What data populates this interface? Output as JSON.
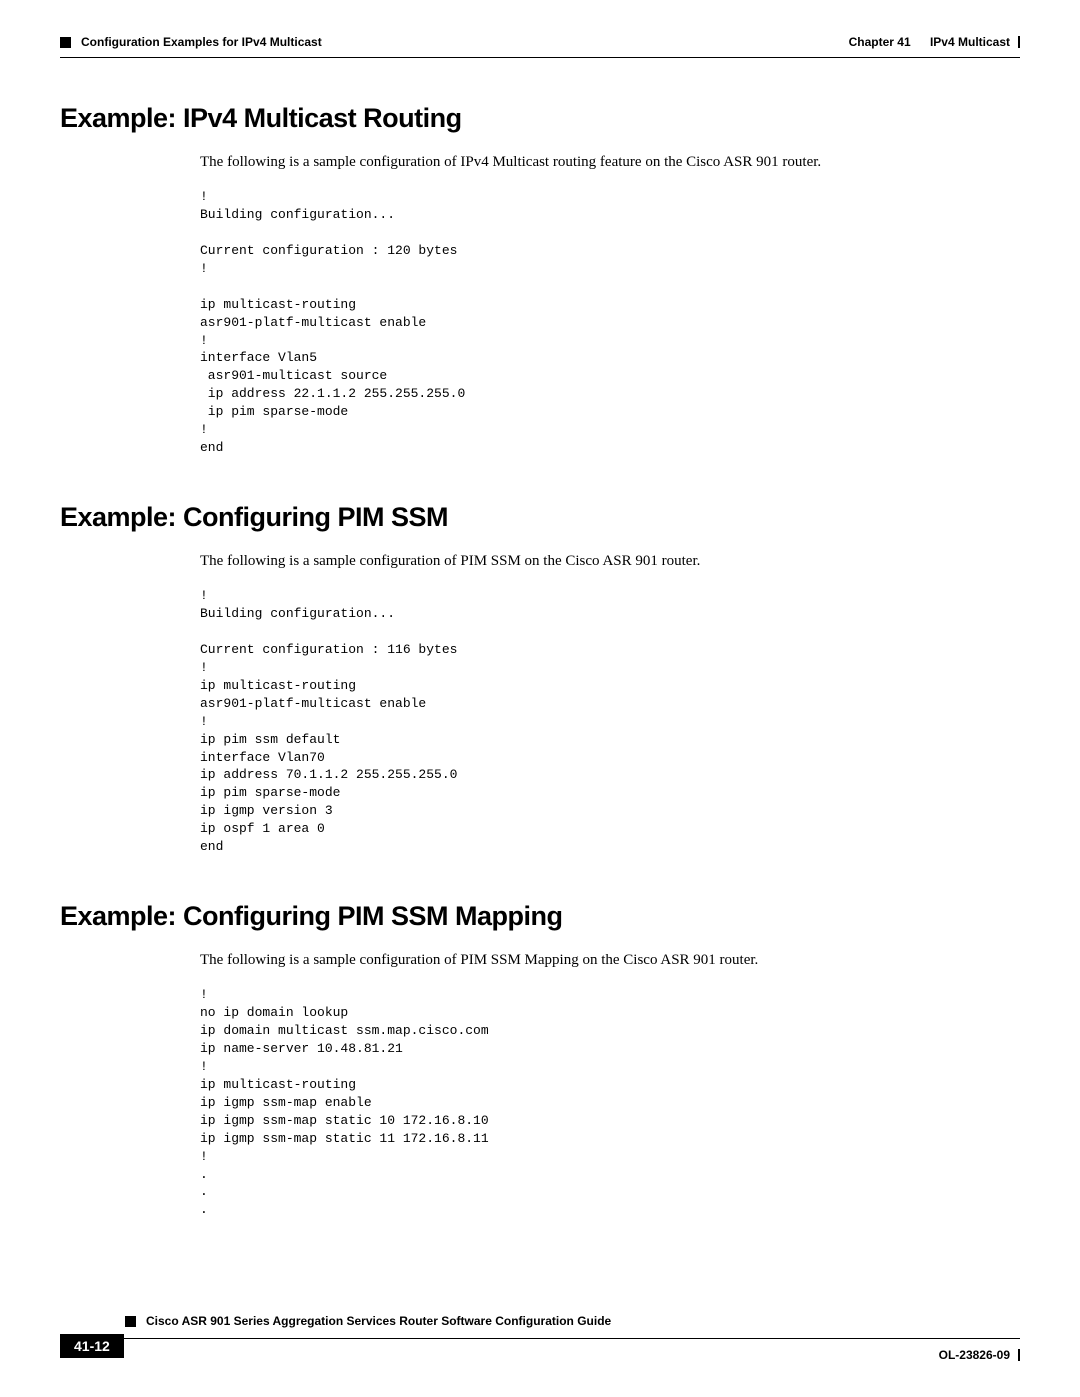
{
  "header": {
    "breadcrumb": "Configuration Examples for IPv4 Multicast",
    "chapter_label": "Chapter 41",
    "chapter_title": "IPv4 Multicast"
  },
  "sections": [
    {
      "heading": "Example: IPv4 Multicast Routing",
      "intro": "The following is a sample configuration of IPv4 Multicast routing feature on the Cisco ASR 901 router.",
      "code": "!\nBuilding configuration...\n\nCurrent configuration : 120 bytes\n!\n\nip multicast-routing\nasr901-platf-multicast enable\n!\ninterface Vlan5\n asr901-multicast source\n ip address 22.1.1.2 255.255.255.0\n ip pim sparse-mode\n!\nend"
    },
    {
      "heading": "Example: Configuring PIM SSM",
      "intro": "The following is a sample configuration of PIM SSM on the Cisco ASR 901 router.",
      "code": "!\nBuilding configuration...\n\nCurrent configuration : 116 bytes\n!\nip multicast-routing\nasr901-platf-multicast enable\n!\nip pim ssm default\ninterface Vlan70\nip address 70.1.1.2 255.255.255.0\nip pim sparse-mode\nip igmp version 3\nip ospf 1 area 0\nend"
    },
    {
      "heading": "Example: Configuring PIM SSM Mapping",
      "intro": "The following is a sample configuration of PIM SSM Mapping on the Cisco ASR 901 router.",
      "code": "!\nno ip domain lookup\nip domain multicast ssm.map.cisco.com\nip name-server 10.48.81.21\n!\nip multicast-routing\nip igmp ssm-map enable\nip igmp ssm-map static 10 172.16.8.10\nip igmp ssm-map static 11 172.16.8.11\n!\n.\n.\n."
    }
  ],
  "footer": {
    "guide_title": "Cisco ASR 901 Series Aggregation Services Router Software Configuration Guide",
    "page_number": "41-12",
    "doc_id": "OL-23826-09"
  }
}
